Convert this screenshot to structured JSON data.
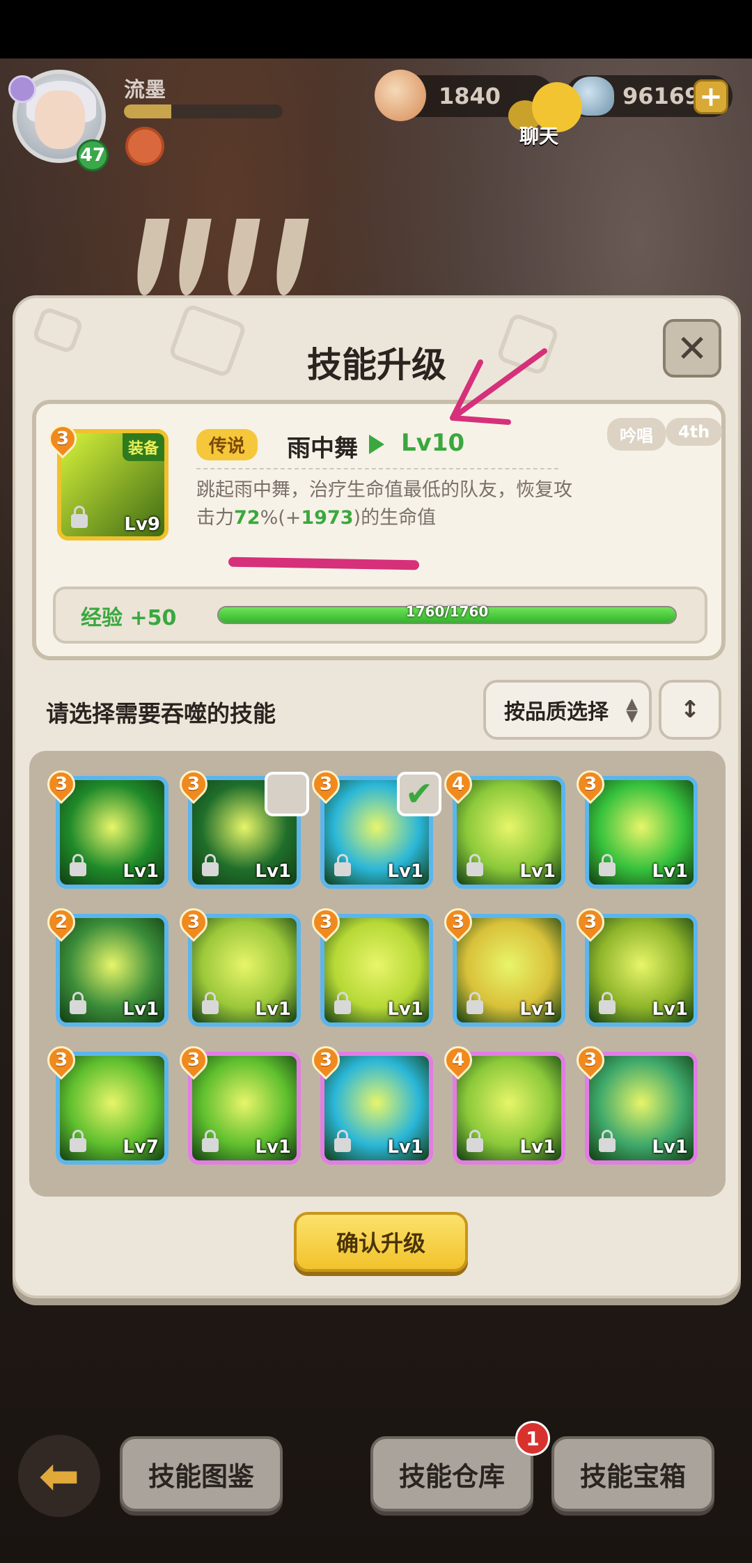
{
  "hud": {
    "player_name": "流墨",
    "player_level": "47",
    "exp_progress": 0.3,
    "shells": "1840",
    "gems": "96169",
    "chat_label": "聊天",
    "add_symbol": "+"
  },
  "panel": {
    "title": "技能升级",
    "close_symbol": "✕"
  },
  "skill": {
    "grade": "3",
    "equip_badge": "装备",
    "level_current": "Lv9",
    "rarity": "传说",
    "name": "雨中舞",
    "level_next": "Lv10",
    "tags": [
      "吟唱",
      "4th"
    ],
    "desc_part1": "跳起雨中舞，治疗生命值最低的队友，恢复攻击力",
    "desc_percent": "72",
    "desc_part2": "%(+",
    "desc_value": "1973",
    "desc_part3": ")的生命值",
    "exp_label": "经验 +50",
    "exp_text": "1760/1760",
    "exp_fraction": 1.0
  },
  "selection": {
    "label": "请选择需要吞噬的技能",
    "quality_button": "按品质选择",
    "sort_icon": "↕"
  },
  "tiles": [
    {
      "grade": "3",
      "level": "Lv1",
      "rarity": "rare",
      "color": "#1f8a2a",
      "checkbox": "none"
    },
    {
      "grade": "3",
      "level": "Lv1",
      "rarity": "rare",
      "color": "#1f6e2b",
      "checkbox": "empty"
    },
    {
      "grade": "3",
      "level": "Lv1",
      "rarity": "rare",
      "color": "#2ab6d8",
      "checkbox": "checked"
    },
    {
      "grade": "4",
      "level": "Lv1",
      "rarity": "rare",
      "color": "#8bc93a",
      "checkbox": "none"
    },
    {
      "grade": "3",
      "level": "Lv1",
      "rarity": "rare",
      "color": "#36c13c",
      "checkbox": "none"
    },
    {
      "grade": "2",
      "level": "Lv1",
      "rarity": "rare",
      "color": "#3b8d3a",
      "checkbox": "none"
    },
    {
      "grade": "3",
      "level": "Lv1",
      "rarity": "rare",
      "color": "#9cc83a",
      "checkbox": "none"
    },
    {
      "grade": "3",
      "level": "Lv1",
      "rarity": "rare",
      "color": "#b6d836",
      "checkbox": "none"
    },
    {
      "grade": "3",
      "level": "Lv1",
      "rarity": "rare",
      "color": "#d9c13a",
      "checkbox": "none"
    },
    {
      "grade": "3",
      "level": "Lv1",
      "rarity": "rare",
      "color": "#8fb52a",
      "checkbox": "none"
    },
    {
      "grade": "3",
      "level": "Lv7",
      "rarity": "rare",
      "color": "#5fbf2e",
      "checkbox": "none"
    },
    {
      "grade": "3",
      "level": "Lv1",
      "rarity": "epic",
      "color": "#5fbf2e",
      "checkbox": "none"
    },
    {
      "grade": "3",
      "level": "Lv1",
      "rarity": "epic",
      "color": "#2ab6d8",
      "checkbox": "none"
    },
    {
      "grade": "4",
      "level": "Lv1",
      "rarity": "epic",
      "color": "#8bc93a",
      "checkbox": "none"
    },
    {
      "grade": "3",
      "level": "Lv1",
      "rarity": "epic",
      "color": "#3ea86a",
      "checkbox": "none"
    }
  ],
  "confirm_button": "确认升级",
  "bottom_nav": {
    "codex": "技能图鉴",
    "warehouse": "技能仓库",
    "warehouse_badge": "1",
    "chest": "技能宝箱"
  },
  "colors": {
    "legendary": "#f6c73b",
    "highlight_green": "#3aa83e",
    "rare_border": "#5bb6ee",
    "epic_border": "#e27de4",
    "annotation": "#d6307a"
  }
}
